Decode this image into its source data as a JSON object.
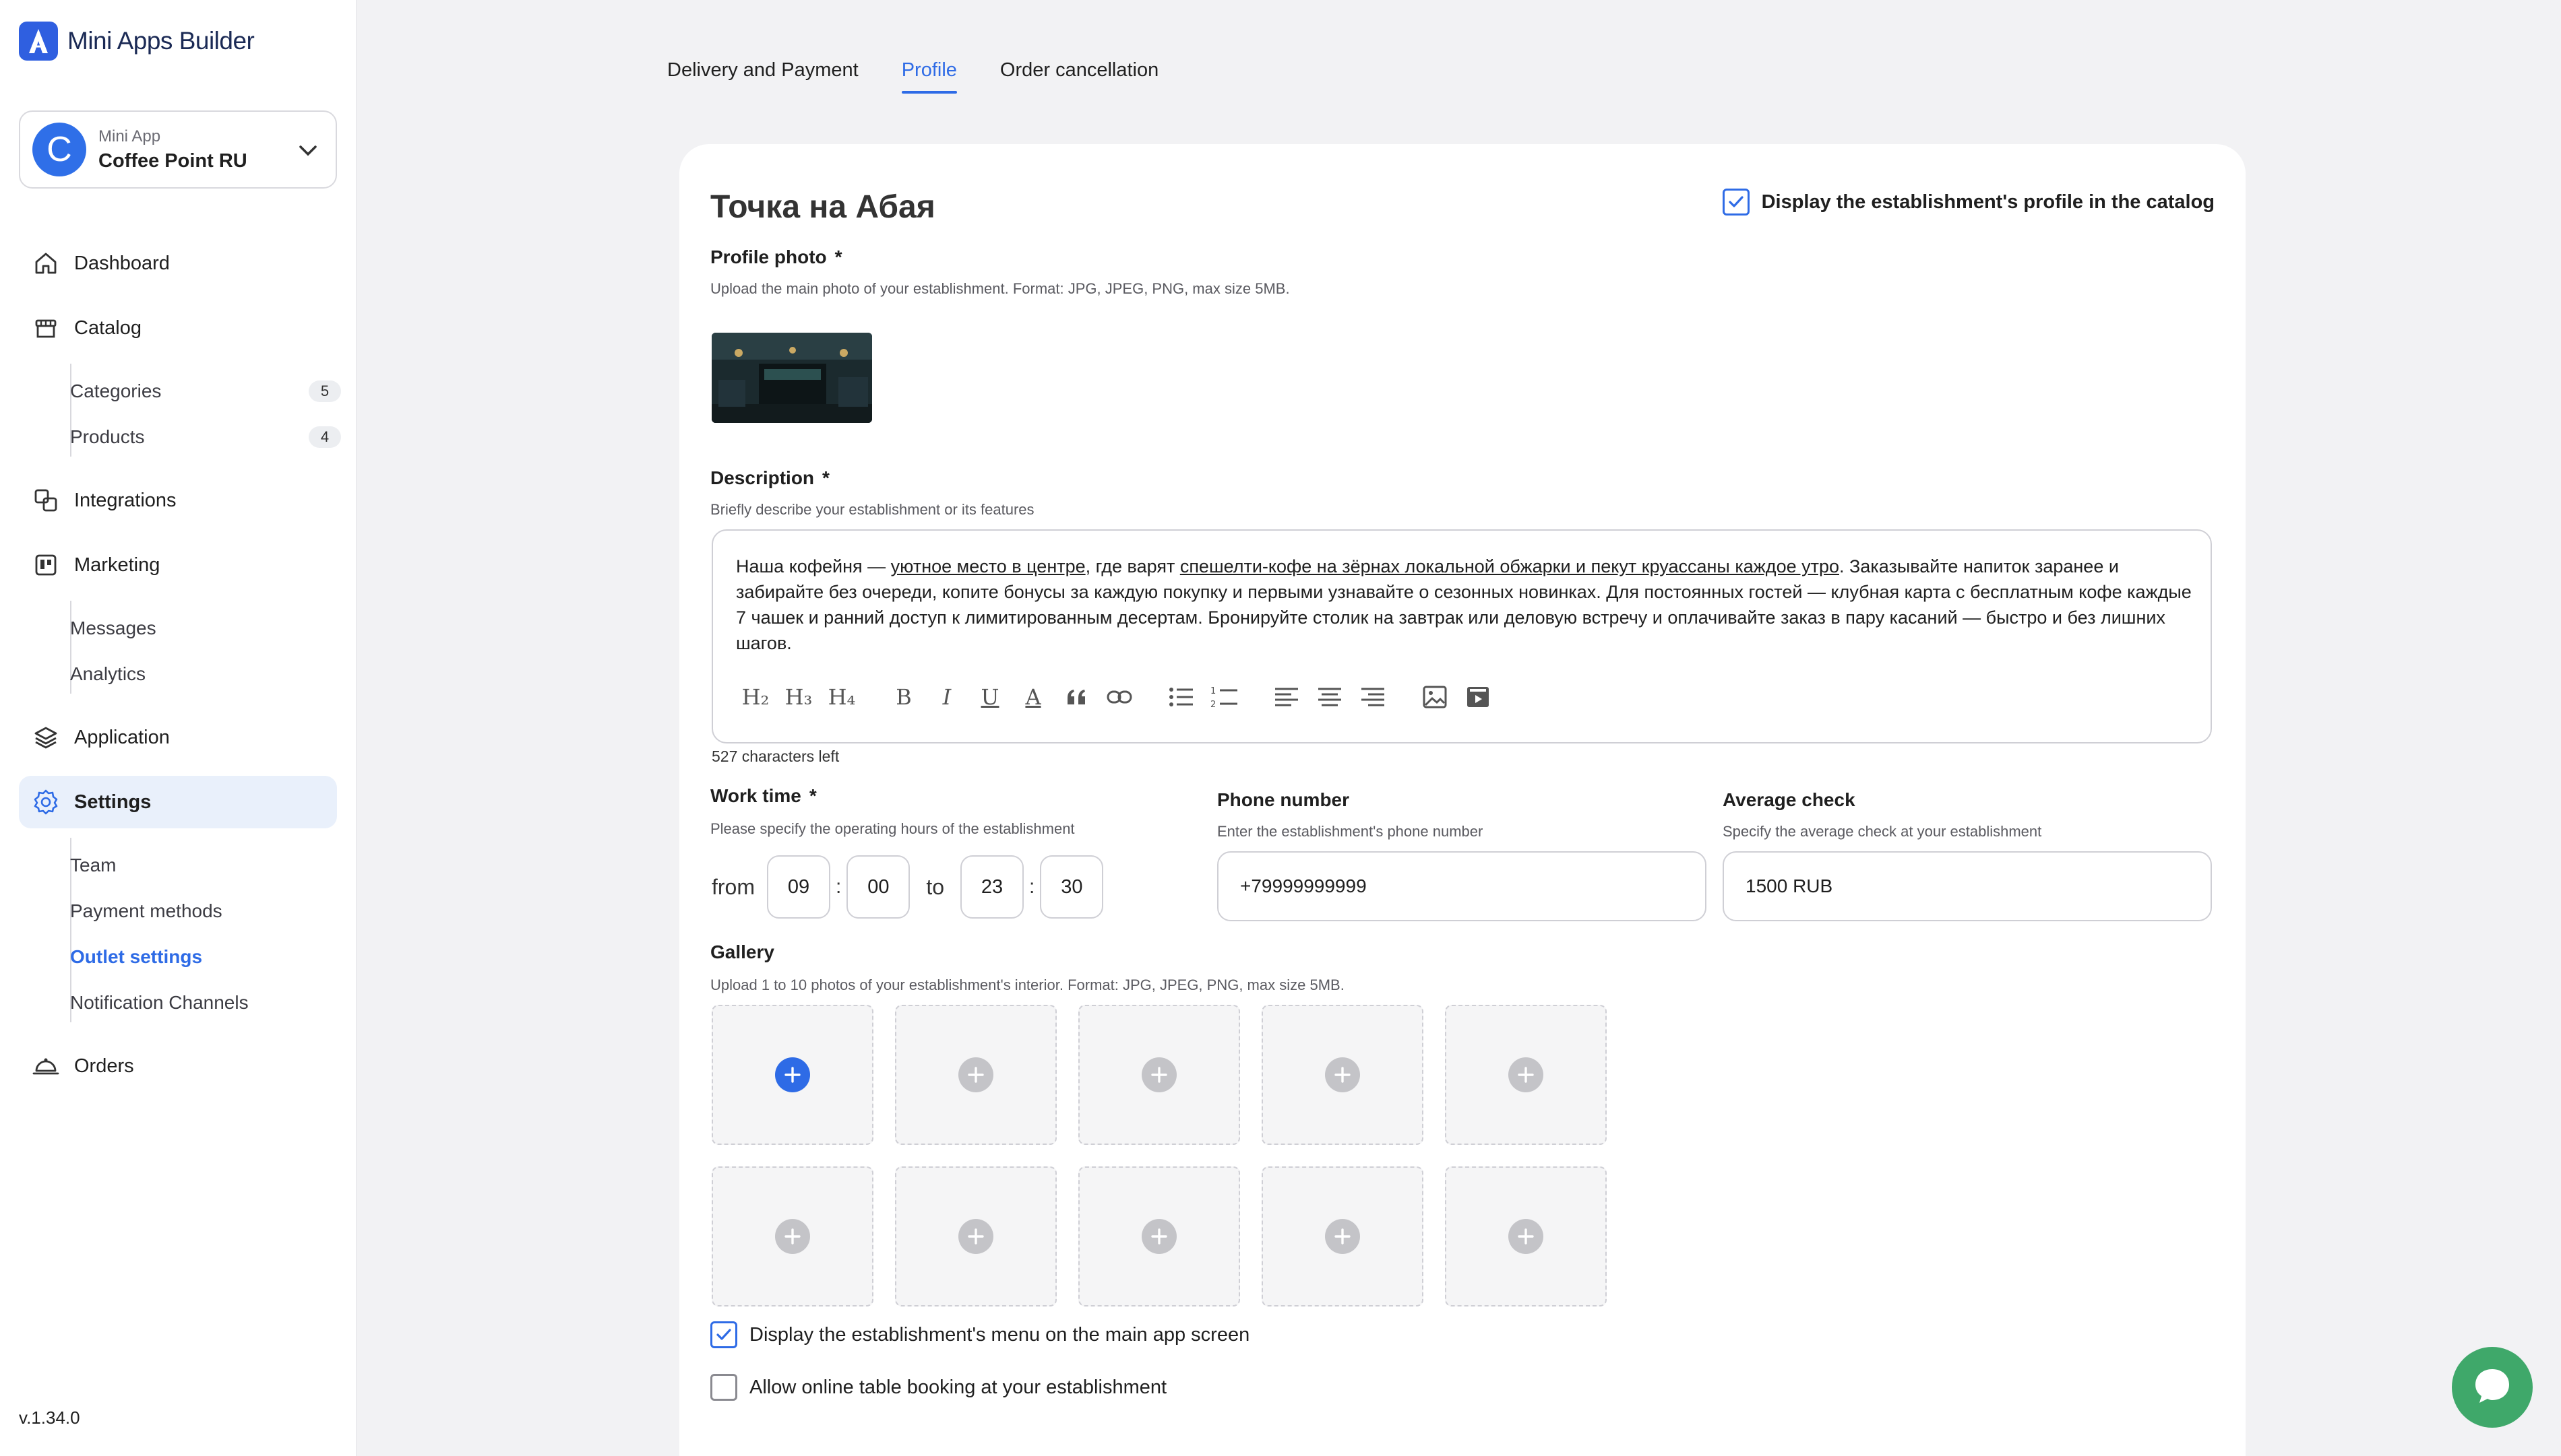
{
  "brand": {
    "name": "Mini Apps Builder"
  },
  "app_switcher": {
    "kicker": "Mini App",
    "name": "Coffee Point RU",
    "initial": "C"
  },
  "sidebar": {
    "dashboard": "Dashboard",
    "catalog": "Catalog",
    "categories": "Categories",
    "categories_count": "5",
    "products": "Products",
    "products_count": "4",
    "integrations": "Integrations",
    "marketing": "Marketing",
    "messages": "Messages",
    "analytics": "Analytics",
    "application": "Application",
    "settings": "Settings",
    "team": "Team",
    "payment_methods": "Payment methods",
    "outlet_settings": "Outlet settings",
    "notification_channels": "Notification Channels",
    "orders": "Orders"
  },
  "version": "v.1.34.0",
  "tabs": [
    "Delivery and Payment",
    "Profile",
    "Order cancellation"
  ],
  "profile": {
    "title": "Точка на Абая",
    "catalog_toggle_label": "Display the establishment's profile in the catalog",
    "photo_label": "Profile photo",
    "required_mark": "*",
    "photo_hint": "Upload the main photo of your establishment. Format: JPG, JPEG, PNG, max size 5MB.",
    "description_label": "Description",
    "description_hint": "Briefly describe your establishment or its features",
    "description_parts": {
      "p1": "Наша кофейня — ",
      "u1": "уютное место в центре",
      "p2": ", где варят ",
      "u2": "спешелти-кофе на зёрнах локальной обжарки и пекут круассаны каждое утро",
      "p3": ". Заказывайте напиток заранее и забирайте без очереди, копите бонусы за каждую покупку и первыми узнавайте о сезонных новинках. Для постоянных гостей — клубная карта с бесплатным кофе каждые 7 чашек и ранний доступ к лимитированным десертам. Бронируйте столик на завтрак или деловую встречу и оплачивайте заказ в пару касаний — быстро и без лишних шагов."
    },
    "chars_left": "527 characters left",
    "work_time_label": "Work time",
    "work_time_hint": "Please specify the operating hours of the establishment",
    "from_label": "from",
    "to_label": "to",
    "from_h": "09",
    "from_m": "00",
    "to_h": "23",
    "to_m": "30",
    "time_sep": ":",
    "phone_label": "Phone number",
    "phone_hint": "Enter the establishment's phone number",
    "phone_value": "+79999999999",
    "avg_label": "Average check",
    "avg_hint": "Specify the average check at your establishment",
    "avg_value": "1500 RUB",
    "gallery_label": "Gallery",
    "gallery_hint": "Upload 1 to 10 photos of your establishment's interior. Format: JPG, JPEG, PNG, max size 5MB.",
    "menu_toggle_label": "Display the establishment's menu on the main app screen",
    "booking_toggle_label": "Allow online table booking at your establishment",
    "toolbar": [
      "H₂",
      "H₃",
      "H₄",
      "B",
      "I",
      "U",
      "A"
    ]
  },
  "colors": {
    "accent": "#2e6be6",
    "chat": "#3fa86a",
    "active_nav_bg": "#e9f0fb"
  }
}
